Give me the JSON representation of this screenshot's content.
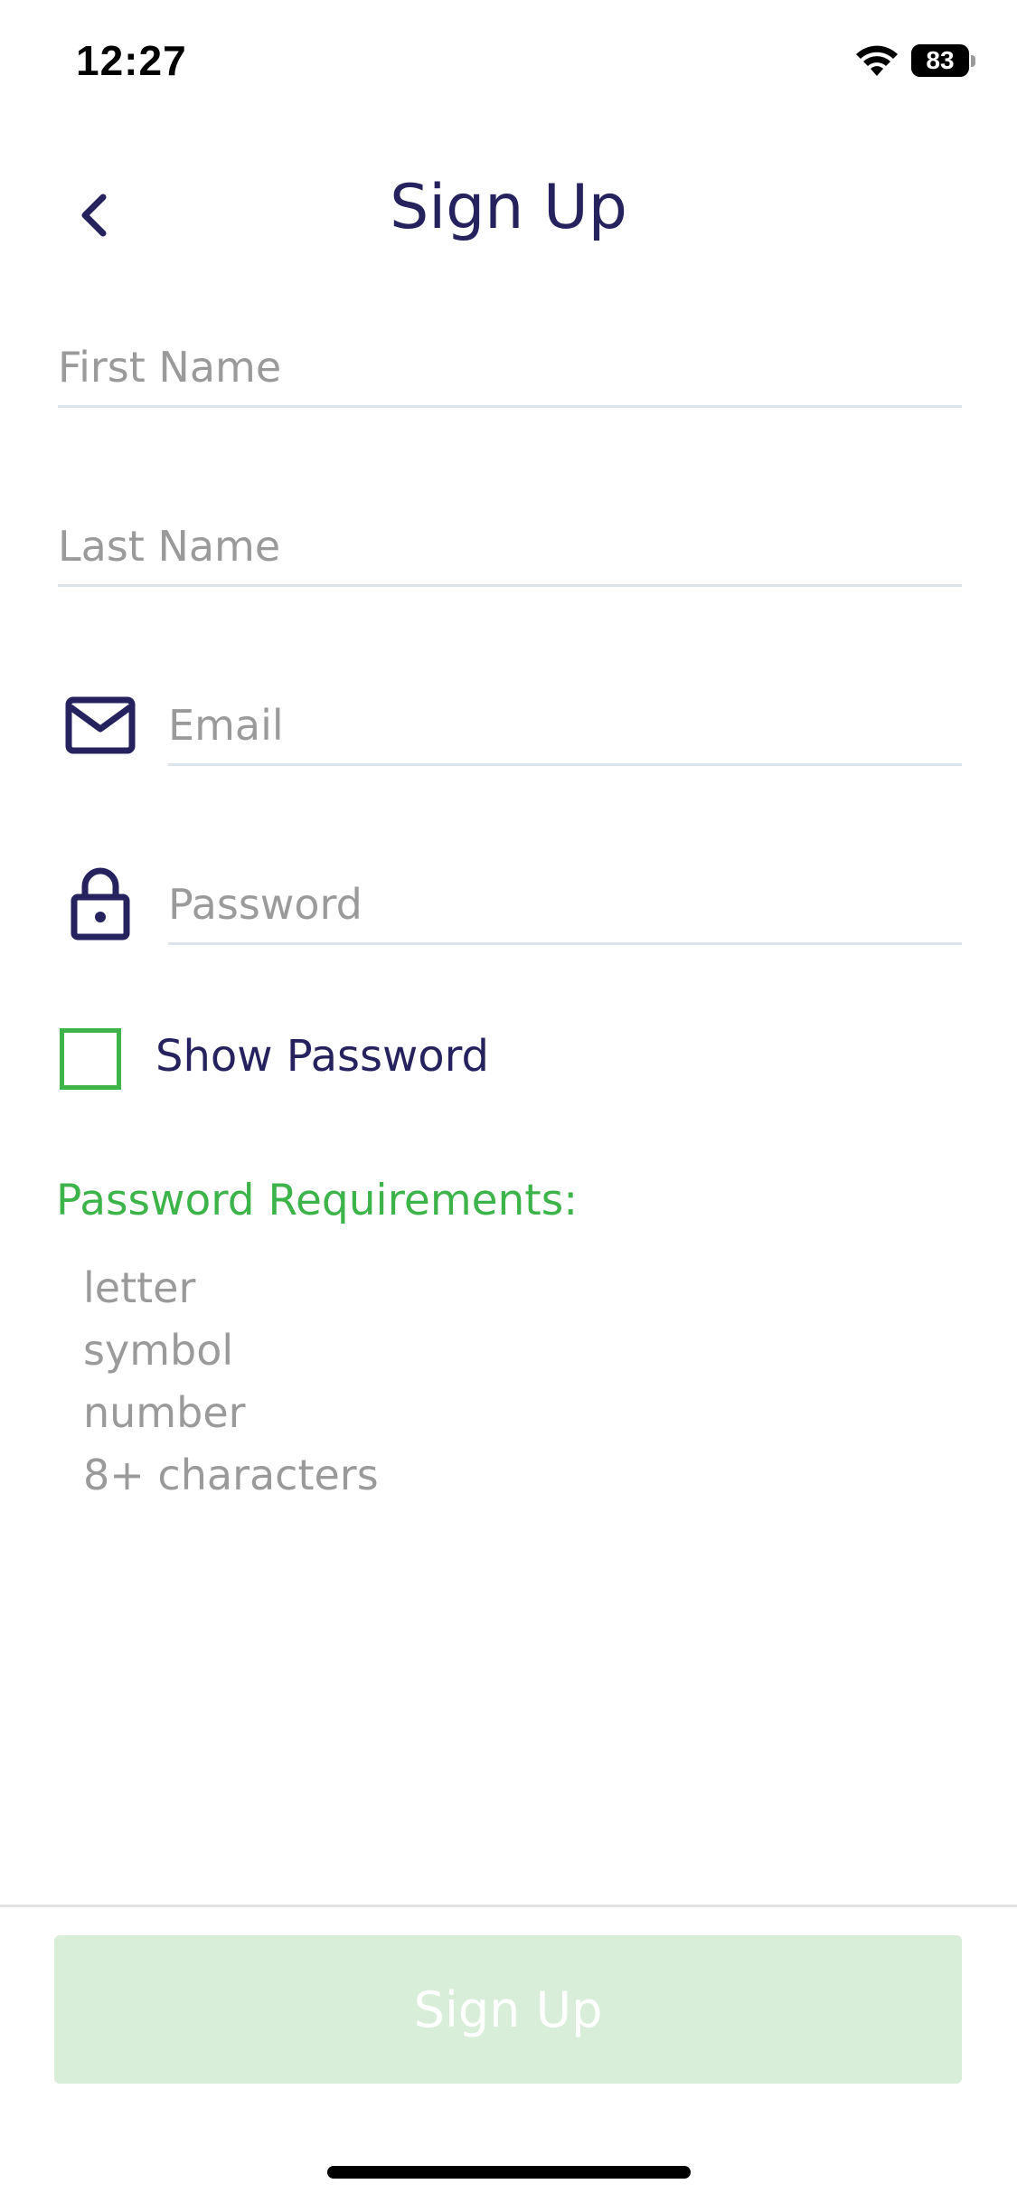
{
  "status_bar": {
    "time": "12:27",
    "battery": "83",
    "battery_level": 0.83
  },
  "header": {
    "title": "Sign Up",
    "back_icon": "chevron-left-icon"
  },
  "form": {
    "first_name_placeholder": "First Name",
    "last_name_placeholder": "Last Name",
    "email_placeholder": "Email",
    "email_icon": "envelope-icon",
    "password_placeholder": "Password",
    "password_icon": "lock-icon",
    "show_password_label": "Show Password",
    "show_password_checked": false
  },
  "requirements": {
    "title": "Password Requirements:",
    "items": [
      "letter",
      "symbol",
      "number",
      "8+ characters"
    ]
  },
  "footer": {
    "signup_label": "Sign Up",
    "signup_enabled": false
  },
  "colors": {
    "primary": "#25225e",
    "accent": "#3db44a",
    "placeholder": "#9a9a9a",
    "button_disabled": "#d8eed8"
  }
}
